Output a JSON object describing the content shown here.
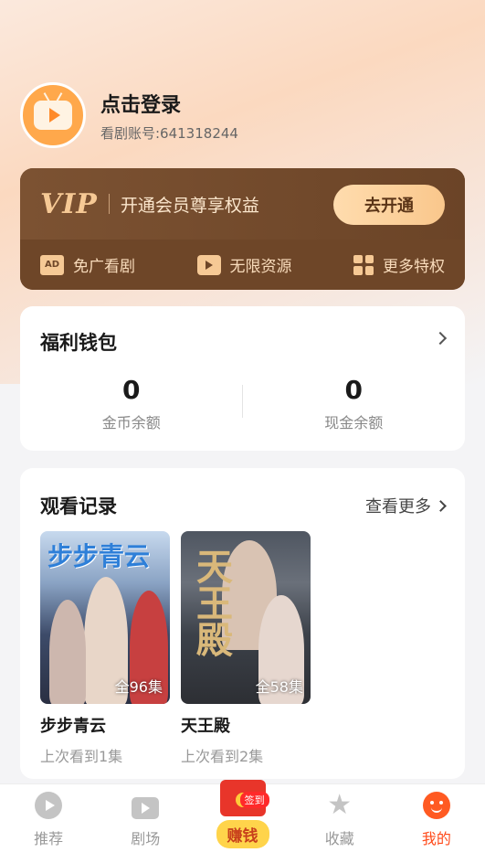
{
  "profile": {
    "login_title": "点击登录",
    "account": "看剧账号:641318244"
  },
  "vip": {
    "logo": "VIP",
    "slogan": "开通会员尊享权益",
    "button": "去开通",
    "benefits": [
      {
        "label": "免广看剧",
        "icon": "ad-icon"
      },
      {
        "label": "无限资源",
        "icon": "tv-icon"
      },
      {
        "label": "更多特权",
        "icon": "grid-icon"
      }
    ],
    "accent": "#f6c995",
    "background": "#6b4427"
  },
  "wallet": {
    "title": "福利钱包",
    "coins": {
      "value": "0",
      "label": "金币余额"
    },
    "cash": {
      "value": "0",
      "label": "现金余额"
    }
  },
  "history": {
    "title": "观看记录",
    "more": "查看更多",
    "items": [
      {
        "poster_title": "步步青云",
        "episodes": "全96集",
        "name": "步步青云",
        "progress": "上次看到1集"
      },
      {
        "poster_title": "天王殿",
        "episodes": "全58集",
        "name": "天王殿",
        "progress": "上次看到2集"
      }
    ]
  },
  "nav": {
    "items": [
      {
        "label": "推荐",
        "icon": "play-circle-icon"
      },
      {
        "label": "剧场",
        "icon": "tv-icon"
      },
      {
        "label": "赚钱",
        "icon": "red-envelope-icon",
        "badge": "签到"
      },
      {
        "label": "收藏",
        "icon": "star-icon"
      },
      {
        "label": "我的",
        "icon": "smile-face-icon",
        "active": true
      }
    ],
    "active_color": "#ff4a1a"
  }
}
